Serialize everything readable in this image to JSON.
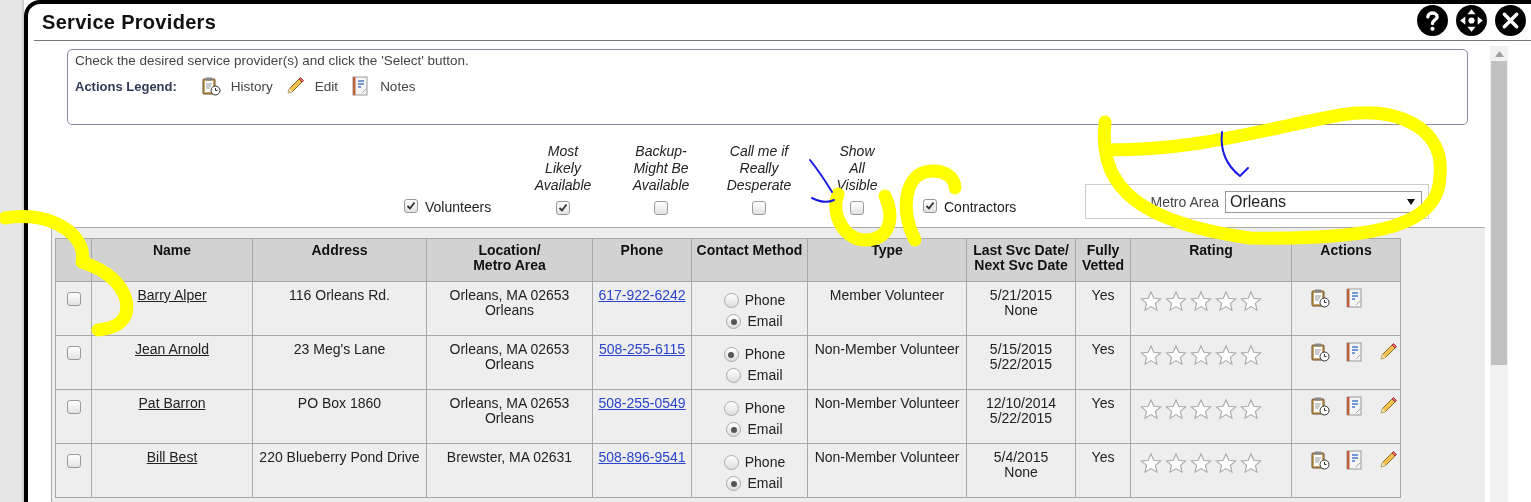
{
  "window": {
    "title": "Service Providers"
  },
  "legend": {
    "instruction": "Check the desired service provider(s) and click the 'Select' button.",
    "label": "Actions Legend:",
    "items": [
      {
        "kind": "history",
        "label": "History"
      },
      {
        "kind": "edit",
        "label": "Edit"
      },
      {
        "kind": "notes",
        "label": "Notes"
      }
    ]
  },
  "filters": [
    {
      "kind": "inline",
      "label": "Volunteers",
      "checked": true
    },
    {
      "kind": "stacked",
      "label": "Most\nLikely\nAvailable",
      "checked": true
    },
    {
      "kind": "stacked",
      "label": "Backup-\nMight Be\nAvailable",
      "checked": false
    },
    {
      "kind": "stacked",
      "label": "Call me if\nReally\nDesperate",
      "checked": false
    },
    {
      "kind": "stacked",
      "label": "Show\nAll\nVisible",
      "checked": false
    },
    {
      "kind": "inline",
      "label": "Contractors",
      "checked": true
    }
  ],
  "metro": {
    "label": "Metro Area",
    "value": "Orleans"
  },
  "table": {
    "columns": [
      "",
      "Name",
      "Address",
      "Location/\nMetro Area",
      "Phone",
      "Contact Method",
      "Type",
      "Last Svc Date/\nNext Svc Date",
      "Fully\nVetted",
      "Rating",
      "Actions"
    ],
    "rows": [
      {
        "checked": false,
        "name": "Barry Alper",
        "address": "116 Orleans Rd.",
        "location": [
          "Orleans, MA 02653",
          "Orleans"
        ],
        "phone": "617-922-6242",
        "contact": [
          {
            "label": "Phone",
            "selected": false
          },
          {
            "label": "Email",
            "selected": true
          }
        ],
        "type": "Member Volunteer",
        "dates": [
          "5/21/2015",
          "None"
        ],
        "vetted": "Yes",
        "stars": 0,
        "actions": [
          {
            "kind": "history"
          },
          {
            "kind": "notes"
          }
        ]
      },
      {
        "checked": false,
        "name": "Jean Arnold",
        "address": "23 Meg's Lane",
        "location": [
          "Orleans, MA 02653",
          "Orleans"
        ],
        "phone": "508-255-6115",
        "contact": [
          {
            "label": "Phone",
            "selected": true
          },
          {
            "label": "Email",
            "selected": false
          }
        ],
        "type": "Non-Member Volunteer",
        "dates": [
          "5/15/2015",
          "5/22/2015"
        ],
        "vetted": "Yes",
        "stars": 0,
        "actions": [
          {
            "kind": "history"
          },
          {
            "kind": "notes"
          },
          {
            "kind": "edit"
          }
        ]
      },
      {
        "checked": false,
        "name": "Pat Barron",
        "address": "PO Box 1860",
        "location": [
          "Orleans, MA 02653",
          "Orleans"
        ],
        "phone": "508-255-0549",
        "contact": [
          {
            "label": "Phone",
            "selected": false
          },
          {
            "label": "Email",
            "selected": true
          }
        ],
        "type": "Non-Member Volunteer",
        "dates": [
          "12/10/2014",
          "5/22/2015"
        ],
        "vetted": "Yes",
        "stars": 0,
        "actions": [
          {
            "kind": "history"
          },
          {
            "kind": "notes"
          },
          {
            "kind": "edit"
          }
        ]
      },
      {
        "checked": false,
        "name": "Bill Best",
        "address": "220 Blueberry Pond Drive",
        "location": [
          "Brewster, MA 02631"
        ],
        "phone": "508-896-9541",
        "contact": [
          {
            "label": "Phone",
            "selected": false
          },
          {
            "label": "Email",
            "selected": true
          }
        ],
        "type": "Non-Member Volunteer",
        "dates": [
          "5/4/2015",
          "None"
        ],
        "vetted": "Yes",
        "stars": 0,
        "actions": [
          {
            "kind": "history"
          },
          {
            "kind": "notes"
          },
          {
            "kind": "edit"
          }
        ]
      }
    ]
  }
}
